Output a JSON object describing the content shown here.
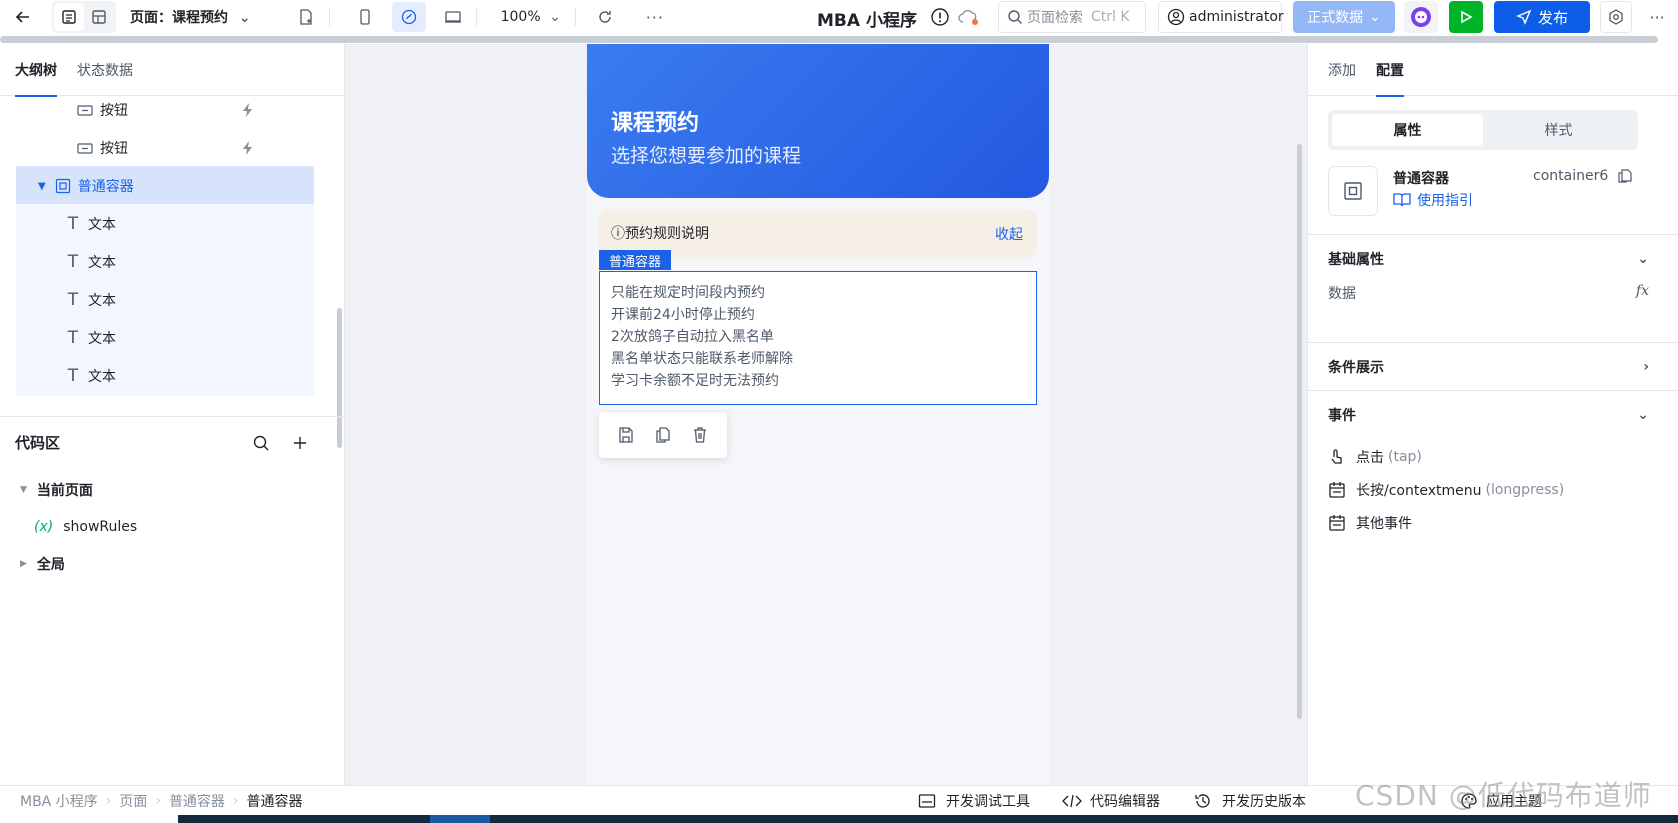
{
  "toolbar": {
    "page_label": "页面：课程预约",
    "zoom": "100%",
    "app_title": "MBA 小程序",
    "search_placeholder": "页面检索",
    "search_shortcut": "Ctrl K",
    "user": "administrator",
    "env_label": "正式数据",
    "publish_label": "发布"
  },
  "left_panel": {
    "tabs": [
      "大纲树",
      "状态数据"
    ],
    "tree": [
      {
        "label": "按钮",
        "icon": "button-icon"
      },
      {
        "label": "按钮",
        "icon": "button-icon"
      },
      {
        "label": "普通容器",
        "icon": "container-icon",
        "selected": true
      },
      {
        "label": "文本",
        "icon": "text-icon"
      },
      {
        "label": "文本",
        "icon": "text-icon"
      },
      {
        "label": "文本",
        "icon": "text-icon"
      },
      {
        "label": "文本",
        "icon": "text-icon"
      },
      {
        "label": "文本",
        "icon": "text-icon"
      }
    ],
    "code_section_title": "代码区",
    "current_page": "当前页面",
    "variable_prefix": "(x)",
    "variable": "showRules",
    "global": "全局"
  },
  "canvas": {
    "hero_title": "课程预约",
    "hero_subtitle": "选择您想要参加的课程",
    "rules_header": "ⓘ预约规则说明",
    "collapse_label": "收起",
    "selected_tag": "普通容器",
    "rules": [
      "只能在规定时间段内预约",
      "开课前24小时停止预约",
      "2次放鸽子自动拉入黑名单",
      "黑名单状态只能联系老师解除",
      "学习卡余额不足时无法预约"
    ]
  },
  "right_panel": {
    "tabs": [
      "添加",
      "配置"
    ],
    "segments": [
      "属性",
      "样式"
    ],
    "component_name": "普通容器",
    "component_id": "container6",
    "guide_label": "使用指引",
    "basic_props": "基础属性",
    "data_label": "数据",
    "fx_label": "fx",
    "conditional": "条件展示",
    "events": "事件",
    "event_items": [
      {
        "label": "点击",
        "sub": "(tap)"
      },
      {
        "label": "长按/contextmenu",
        "sub": "(longpress)"
      },
      {
        "label": "其他事件",
        "sub": ""
      }
    ]
  },
  "bottom_bar": {
    "breadcrumb": [
      "MBA 小程序",
      "页面",
      "普通容器",
      "普通容器"
    ],
    "dev_tools": "开发调试工具",
    "code_editor": "代码编辑器",
    "history": "开发历史版本",
    "theme": "应用主题"
  },
  "watermark": "CSDN @低代码布道师",
  "colors": {
    "primary": "#1a62e8",
    "hero_start": "#3a7cf0",
    "hero_end": "#2358e0",
    "rules_bg": "#f6efe6"
  }
}
